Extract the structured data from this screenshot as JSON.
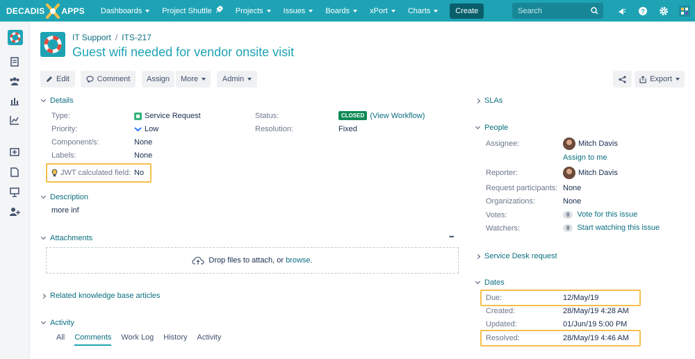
{
  "brand": {
    "left": "DECADIS",
    "right": "APPS"
  },
  "nav": {
    "items": [
      "Dashboards",
      "Project Shuttle",
      "Projects",
      "Issues",
      "Boards",
      "xPort",
      "Charts"
    ],
    "create_label": "Create",
    "search_placeholder": "Search"
  },
  "issue": {
    "project": "IT Support",
    "key": "ITS-217",
    "summary": "Guest wifi needed for vendor onsite visit"
  },
  "toolbar": {
    "edit": "Edit",
    "comment": "Comment",
    "assign": "Assign",
    "more": "More",
    "admin": "Admin",
    "export": "Export"
  },
  "details": {
    "heading": "Details",
    "type_label": "Type:",
    "type_value": "Service Request",
    "priority_label": "Priority:",
    "priority_value": "Low",
    "components_label": "Component/s:",
    "components_value": "None",
    "labels_label": "Labels:",
    "labels_value": "None",
    "jwt_label": "JWT calculated field:",
    "jwt_value": "No",
    "status_label": "Status:",
    "status_badge": "CLOSED",
    "status_workflow": "(View Workflow)",
    "resolution_label": "Resolution:",
    "resolution_value": "Fixed"
  },
  "description": {
    "heading": "Description",
    "text": "more inf"
  },
  "attachments": {
    "heading": "Attachments",
    "more": "•••",
    "drop_text": "Drop files to attach, or",
    "browse": "browse."
  },
  "knowledge": {
    "heading": "Related knowledge base articles"
  },
  "activity": {
    "heading": "Activity",
    "tabs": [
      "All",
      "Comments",
      "Work Log",
      "History",
      "Activity"
    ]
  },
  "slas": {
    "heading": "SLAs"
  },
  "people": {
    "heading": "People",
    "assignee_label": "Assignee:",
    "assignee_value": "Mitch Davis",
    "assign_to_me": "Assign to me",
    "reporter_label": "Reporter:",
    "reporter_value": "Mitch Davis",
    "participants_label": "Request participants:",
    "participants_value": "None",
    "organizations_label": "Organizations:",
    "organizations_value": "None",
    "votes_label": "Votes:",
    "votes_count": "0",
    "votes_link": "Vote for this issue",
    "watchers_label": "Watchers:",
    "watchers_count": "0",
    "watchers_link": "Start watching this issue"
  },
  "service_desk": {
    "heading": "Service Desk request"
  },
  "dates": {
    "heading": "Dates",
    "due_label": "Due:",
    "due_value": "12/May/19",
    "created_label": "Created:",
    "created_value": "28/May/19 4:28 AM",
    "updated_label": "Updated:",
    "updated_value": "01/Jun/19 5:00 PM",
    "resolved_label": "Resolved:",
    "resolved_value": "28/May/19 4:46 AM"
  },
  "colors": {
    "accent": "#1ea3b5",
    "highlight": "#f6c04b",
    "closed": "#0d8a55"
  }
}
